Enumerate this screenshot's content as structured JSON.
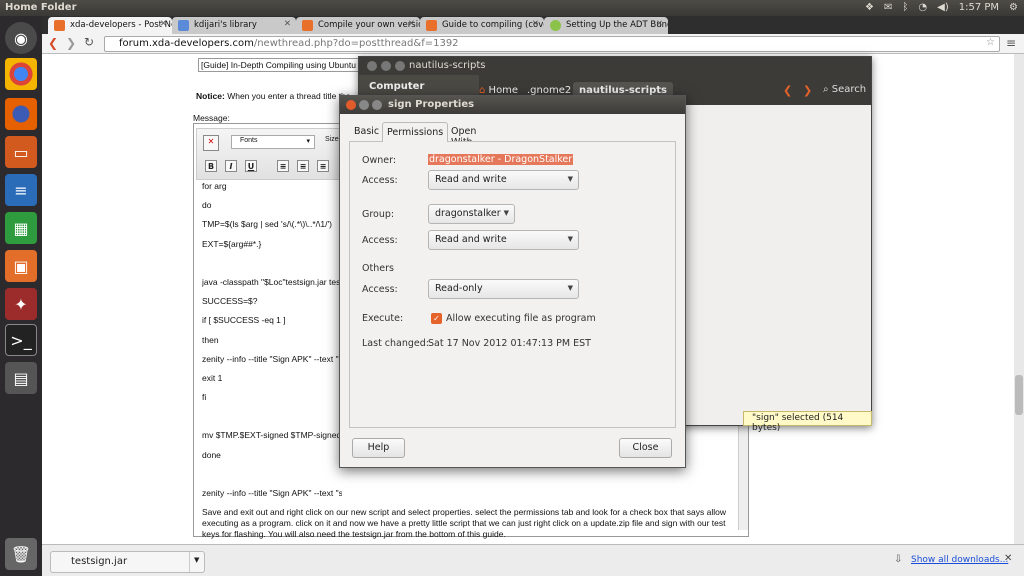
{
  "top_panel": {
    "title": "Home Folder",
    "time": "1:57 PM"
  },
  "tabs": [
    {
      "label": "xda-developers - Post New",
      "color": "#e8702a"
    },
    {
      "label": "kdijari's library",
      "color": "#5a8ad8"
    },
    {
      "label": "Compile your own version",
      "color": "#e8702a"
    },
    {
      "label": "Guide to compiling (covers",
      "color": "#e8702a"
    },
    {
      "label": "Setting Up the ADT Bundl",
      "color": "#8bc34a"
    }
  ],
  "toolbar": {
    "url_host": "forum.xda-developers.com",
    "url_path": "/newthread.php?do=postthread&f=1392"
  },
  "page": {
    "thread_title": "[Guide] In-Depth Compiling using Ubuntu 1",
    "notice_label": "Notice:",
    "notice_text": "When you enter a thread title the",
    "message_label": "Message:",
    "font_select": "Fonts",
    "size_select": "Size",
    "bold": "B",
    "italic": "I",
    "underline": "U",
    "code_lines": [
      "for arg",
      "do",
      "TMP=$(ls $arg | sed 's/\\(.*\\)\\..*/\\1/')",
      "EXT=${arg##*.}",
      "",
      "java -classpath \"$Loc\"testsign.jar tes",
      "SUCCESS=$?",
      "if [ $SUCCESS -eq 1 ]",
      "then",
      "zenity --info --title \"Sign APK\" --text \"",
      "exit 1",
      "fi",
      "",
      "mv $TMP.$EXT-signed $TMP-signed",
      "done",
      "",
      "zenity --info --title \"Sign APK\" --text \"signing completed!\"[/CODE]"
    ],
    "paragraph": "Save and exit out and right click on our new script and select properties. select the permissions tab and look for a check box that says allow executing as a program. click on it and now we have a pretty little script that we can just right click on a update.zip file and sign with our test keys for flashing.  You will also need the testsign.jar from the bottom of this guide."
  },
  "nautilus": {
    "title": "nautilus-scripts",
    "sidebar_heading": "Computer",
    "crumbs": [
      "Home",
      ".gnome2",
      "nautilus-scripts"
    ],
    "search": "Search",
    "status": "\"sign\" selected (514 bytes)"
  },
  "dialog": {
    "title": "sign Properties",
    "tabs": [
      "Basic",
      "Permissions",
      "Open With"
    ],
    "owner_label": "Owner:",
    "owner_value": "dragonstalker - DragonStalker",
    "access_label": "Access:",
    "owner_access": "Read and write",
    "group_label": "Group:",
    "group_value": "dragonstalker",
    "group_access": "Read and write",
    "others_label": "Others",
    "others_access": "Read-only",
    "execute_label": "Execute:",
    "execute_checkbox": "Allow executing file as program",
    "changed_label": "Last changed:",
    "changed_value": "Sat 17 Nov 2012 01:47:13 PM EST",
    "help": "Help",
    "close": "Close"
  },
  "downloads": {
    "file": "testsign.jar",
    "show_all": "Show all downloads..."
  }
}
